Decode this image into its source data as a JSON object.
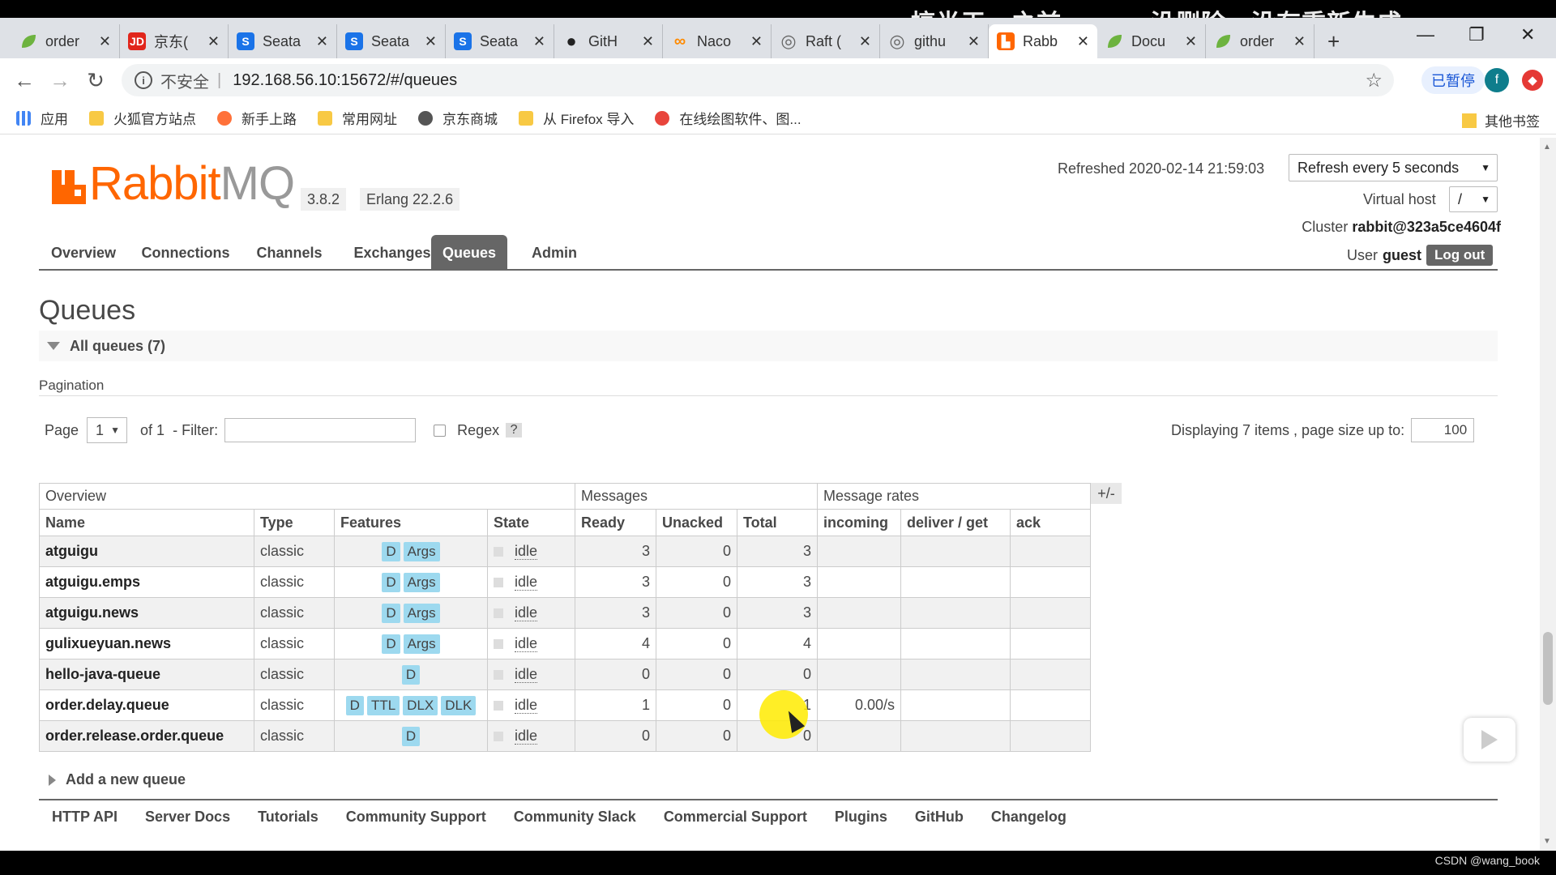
{
  "overlay_caption": "搞半天，之前queue没删除，没有重新生成",
  "browser": {
    "tabs": [
      {
        "label": "order",
        "icon": "leaf-icon",
        "color": "#6db33f",
        "glyph": "",
        "active": false
      },
      {
        "label": "京东(",
        "icon": "jd-icon",
        "color": "#e1251b",
        "glyph": "JD",
        "active": false
      },
      {
        "label": "Seata",
        "icon": "seata-icon",
        "color": "#1a73e8",
        "glyph": "S",
        "active": false
      },
      {
        "label": "Seata",
        "icon": "seata-icon",
        "color": "#1a73e8",
        "glyph": "S",
        "active": false
      },
      {
        "label": "Seata",
        "icon": "seata-icon",
        "color": "#1a73e8",
        "glyph": "S",
        "active": false
      },
      {
        "label": "GitH",
        "icon": "github-icon",
        "color": "#222222",
        "glyph": "●",
        "active": false
      },
      {
        "label": "Naco",
        "icon": "nacos-icon",
        "color": "#ff8a00",
        "glyph": "∞",
        "active": false
      },
      {
        "label": "Raft (",
        "icon": "globe-icon",
        "color": "#666666",
        "glyph": "◎",
        "active": false
      },
      {
        "label": "githu",
        "icon": "globe-icon",
        "color": "#666666",
        "glyph": "◎",
        "active": false
      },
      {
        "label": "Rabb",
        "icon": "rabbitmq-icon",
        "color": "#ff6600",
        "glyph": "▙",
        "active": true
      },
      {
        "label": "Docu",
        "icon": "leaf-icon",
        "color": "#6db33f",
        "glyph": "",
        "active": false
      },
      {
        "label": "order",
        "icon": "leaf-icon",
        "color": "#6db33f",
        "glyph": "",
        "active": false
      }
    ],
    "insecure_label": "不安全",
    "url": "192.168.56.10:15672/#/queues",
    "paused_label": "已暂停",
    "profile_letter": "f",
    "bookmarks": [
      {
        "label": "应用",
        "icon": "apps-grid-icon"
      },
      {
        "label": "火狐官方站点",
        "icon": "folder-icon"
      },
      {
        "label": "新手上路",
        "icon": "firefox-icon"
      },
      {
        "label": "常用网址",
        "icon": "folder-icon"
      },
      {
        "label": "京东商城",
        "icon": "globe-icon"
      },
      {
        "label": "从 Firefox 导入",
        "icon": "folder-icon"
      },
      {
        "label": "在线绘图软件、图...",
        "icon": "drawing-icon"
      }
    ],
    "other_bookmarks": "其他书签"
  },
  "header": {
    "brand_main": "Rabbit",
    "brand_mq": "MQ",
    "version": "3.8.2",
    "erlang": "Erlang 22.2.6",
    "refreshed": "Refreshed 2020-02-14 21:59:03",
    "refresh_option": "Refresh every 5 seconds",
    "virtual_host_label": "Virtual host",
    "virtual_host_value": "/",
    "cluster_label": "Cluster",
    "cluster_value": "rabbit@323a5ce4604f",
    "user_label": "User",
    "user_value": "guest",
    "logout": "Log out"
  },
  "nav": [
    {
      "label": "Overview",
      "active": false
    },
    {
      "label": "Connections",
      "active": false
    },
    {
      "label": "Channels",
      "active": false
    },
    {
      "label": "Exchanges",
      "active": false
    },
    {
      "label": "Queues",
      "active": true
    },
    {
      "label": "Admin",
      "active": false
    }
  ],
  "page_title": "Queues",
  "all_queues_label": "All queues (7)",
  "pagination": {
    "title": "Pagination",
    "page_label": "Page",
    "page_value": "1",
    "of_label": "of 1",
    "filter_label": "- Filter:",
    "regex_label": "Regex",
    "help": "?",
    "display_info": "Displaying 7 items , page size up to:",
    "page_size": "100"
  },
  "table": {
    "groups": [
      "Overview",
      "Messages",
      "Message rates"
    ],
    "toggle": "+/-",
    "columns": [
      "Name",
      "Type",
      "Features",
      "State",
      "Ready",
      "Unacked",
      "Total",
      "incoming",
      "deliver / get",
      "ack"
    ],
    "rows": [
      {
        "name": "atguigu",
        "type": "classic",
        "features": [
          "D",
          "Args"
        ],
        "state": "idle",
        "ready": "3",
        "unacked": "0",
        "total": "3",
        "incoming": "",
        "deliver": "",
        "ack": ""
      },
      {
        "name": "atguigu.emps",
        "type": "classic",
        "features": [
          "D",
          "Args"
        ],
        "state": "idle",
        "ready": "3",
        "unacked": "0",
        "total": "3",
        "incoming": "",
        "deliver": "",
        "ack": ""
      },
      {
        "name": "atguigu.news",
        "type": "classic",
        "features": [
          "D",
          "Args"
        ],
        "state": "idle",
        "ready": "3",
        "unacked": "0",
        "total": "3",
        "incoming": "",
        "deliver": "",
        "ack": ""
      },
      {
        "name": "gulixueyuan.news",
        "type": "classic",
        "features": [
          "D",
          "Args"
        ],
        "state": "idle",
        "ready": "4",
        "unacked": "0",
        "total": "4",
        "incoming": "",
        "deliver": "",
        "ack": ""
      },
      {
        "name": "hello-java-queue",
        "type": "classic",
        "features": [
          "D"
        ],
        "state": "idle",
        "ready": "0",
        "unacked": "0",
        "total": "0",
        "incoming": "",
        "deliver": "",
        "ack": ""
      },
      {
        "name": "order.delay.queue",
        "type": "classic",
        "features": [
          "D",
          "TTL",
          "DLX",
          "DLK"
        ],
        "state": "idle",
        "ready": "1",
        "unacked": "0",
        "total": "1",
        "incoming": "0.00/s",
        "deliver": "",
        "ack": ""
      },
      {
        "name": "order.release.order.queue",
        "type": "classic",
        "features": [
          "D"
        ],
        "state": "idle",
        "ready": "0",
        "unacked": "0",
        "total": "0",
        "incoming": "",
        "deliver": "",
        "ack": ""
      }
    ]
  },
  "add_queue": "Add a new queue",
  "footer": [
    "HTTP API",
    "Server Docs",
    "Tutorials",
    "Community Support",
    "Community Slack",
    "Commercial Support",
    "Plugins",
    "GitHub",
    "Changelog"
  ],
  "watermark": "CSDN @wang_book"
}
